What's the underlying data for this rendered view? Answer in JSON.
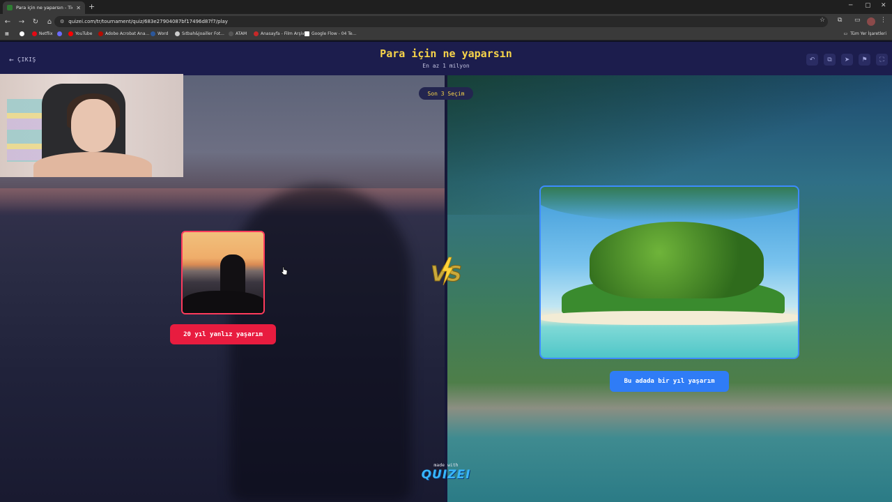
{
  "browser": {
    "tab_title": "Para için ne yaparsın - Tier List",
    "url": "quizei.com/tr/tournament/quiz/683e27904087bf17496d87f7/play",
    "bookmarks": [
      {
        "label": "Netflix",
        "color": "#e50914"
      },
      {
        "label": "YouTube",
        "color": "#ff0000"
      },
      {
        "label": "Adobe Acrobat Ana...",
        "color": "#b30b00"
      },
      {
        "label": "Word",
        "color": "#2b579a"
      },
      {
        "label": "Sıtbah&Joailler Fot...",
        "color": "#cccccc"
      },
      {
        "label": "ATAM",
        "color": "#555555"
      },
      {
        "label": "Anasayfa - Film Arşivi",
        "color": "#c62828"
      },
      {
        "label": "Google Flow - 04 Te...",
        "color": "#ffffff"
      }
    ],
    "all_bookmarks": "Tüm Yer İşaretleri"
  },
  "header": {
    "exit_label": "ÇIKIŞ",
    "title": "Para için ne yaparsın",
    "subtitle": "En az 1 milyon",
    "icons": [
      "undo-icon",
      "copy-icon",
      "send-icon",
      "flag-icon",
      "fullscreen-icon"
    ]
  },
  "arena": {
    "last_choices": "Son 3 Seçim",
    "left_option": "20 yıl yanlız yaşarım",
    "right_option": "Bu adada bir yıl yaşarım",
    "vs": "VS"
  },
  "footer": {
    "made_with": "made with",
    "brand": "QUIZEI"
  },
  "colors": {
    "accent_yellow": "#f7d44a",
    "left_red": "#e81c3f",
    "right_blue": "#2f7cf6",
    "header_bg": "#1c1d4d"
  }
}
